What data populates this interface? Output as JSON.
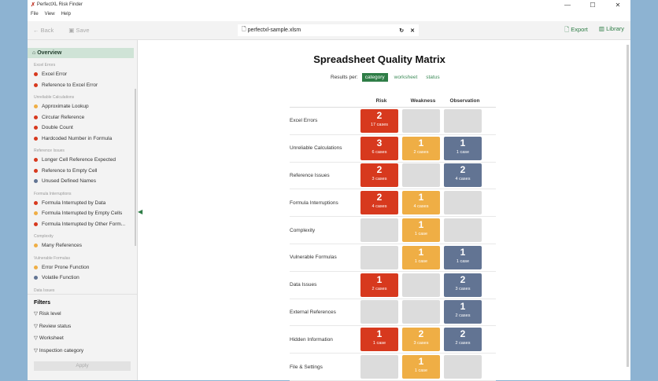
{
  "window": {
    "title": "PerfectXL Risk Finder",
    "menu": [
      "File",
      "View",
      "Help"
    ],
    "controls": [
      "—",
      "☐",
      "✕"
    ]
  },
  "toolbar": {
    "back": "← Back",
    "save": "Save",
    "file": "perfectxl-sample.xlsm",
    "reload": "↻",
    "close": "✕",
    "export": "Export",
    "library": "Library"
  },
  "sidebar": {
    "overview": "Overview",
    "groups": [
      {
        "name": "Excel Errors",
        "items": [
          {
            "label": "Excel Error",
            "color": "#d7391e"
          },
          {
            "label": "Reference to Excel Error",
            "color": "#d7391e"
          }
        ]
      },
      {
        "name": "Unreliable Calculations",
        "items": [
          {
            "label": "Approximate Lookup",
            "color": "#efae45"
          },
          {
            "label": "Circular Reference",
            "color": "#d7391e"
          },
          {
            "label": "Double Count",
            "color": "#d7391e"
          },
          {
            "label": "Hardcoded Number in Formula",
            "color": "#d7391e"
          }
        ]
      },
      {
        "name": "Reference Issues",
        "items": [
          {
            "label": "Longer Cell Reference Expected",
            "color": "#d7391e"
          },
          {
            "label": "Reference to Empty Cell",
            "color": "#d7391e"
          },
          {
            "label": "Unused Defined Names",
            "color": "#627493"
          }
        ]
      },
      {
        "name": "Formula Interruptions",
        "items": [
          {
            "label": "Formula Interrupted by Data",
            "color": "#d7391e"
          },
          {
            "label": "Formula Interrupted by Empty Cells",
            "color": "#efae45"
          },
          {
            "label": "Formula Interrupted by Other Form...",
            "color": "#d7391e"
          }
        ]
      },
      {
        "name": "Complexity",
        "items": [
          {
            "label": "Many References",
            "color": "#efae45"
          }
        ]
      },
      {
        "name": "Vulnerable Formulas",
        "items": [
          {
            "label": "Error Prone Function",
            "color": "#efae45"
          },
          {
            "label": "Volatile Function",
            "color": "#627493"
          }
        ]
      },
      {
        "name": "Data Issues",
        "items": []
      }
    ],
    "filters_title": "Filters",
    "filters": [
      "Risk level",
      "Review status",
      "Worksheet",
      "Inspection category"
    ],
    "apply": "Apply"
  },
  "main": {
    "title": "Spreadsheet Quality Matrix",
    "results_per": "Results per:",
    "modes": [
      "category",
      "worksheet",
      "status"
    ],
    "columns": [
      "Risk",
      "Weakness",
      "Observation"
    ],
    "rows": [
      {
        "label": "Excel Errors",
        "cells": [
          {
            "n": "2",
            "c": "17 cases"
          },
          null,
          null
        ]
      },
      {
        "label": "Unreliable Calculations",
        "cells": [
          {
            "n": "3",
            "c": "6 cases"
          },
          {
            "n": "1",
            "c": "2 cases"
          },
          {
            "n": "1",
            "c": "1 case"
          }
        ]
      },
      {
        "label": "Reference Issues",
        "cells": [
          {
            "n": "2",
            "c": "3 cases"
          },
          null,
          {
            "n": "2",
            "c": "4 cases"
          }
        ]
      },
      {
        "label": "Formula Interruptions",
        "cells": [
          {
            "n": "2",
            "c": "4 cases"
          },
          {
            "n": "1",
            "c": "4 cases"
          },
          null
        ]
      },
      {
        "label": "Complexity",
        "cells": [
          null,
          {
            "n": "1",
            "c": "1 case"
          },
          null
        ]
      },
      {
        "label": "Vulnerable Formulas",
        "cells": [
          null,
          {
            "n": "1",
            "c": "1 case"
          },
          {
            "n": "1",
            "c": "1 case"
          }
        ]
      },
      {
        "label": "Data Issues",
        "cells": [
          {
            "n": "1",
            "c": "2 cases"
          },
          null,
          {
            "n": "2",
            "c": "3 cases"
          }
        ]
      },
      {
        "label": "External References",
        "cells": [
          null,
          null,
          {
            "n": "1",
            "c": "2 cases"
          }
        ]
      },
      {
        "label": "Hidden Information",
        "cells": [
          {
            "n": "1",
            "c": "1 case"
          },
          {
            "n": "2",
            "c": "3 cases"
          },
          {
            "n": "2",
            "c": "2 cases"
          }
        ]
      },
      {
        "label": "File & Settings",
        "cells": [
          null,
          {
            "n": "1",
            "c": "1 case"
          },
          null
        ]
      }
    ]
  }
}
